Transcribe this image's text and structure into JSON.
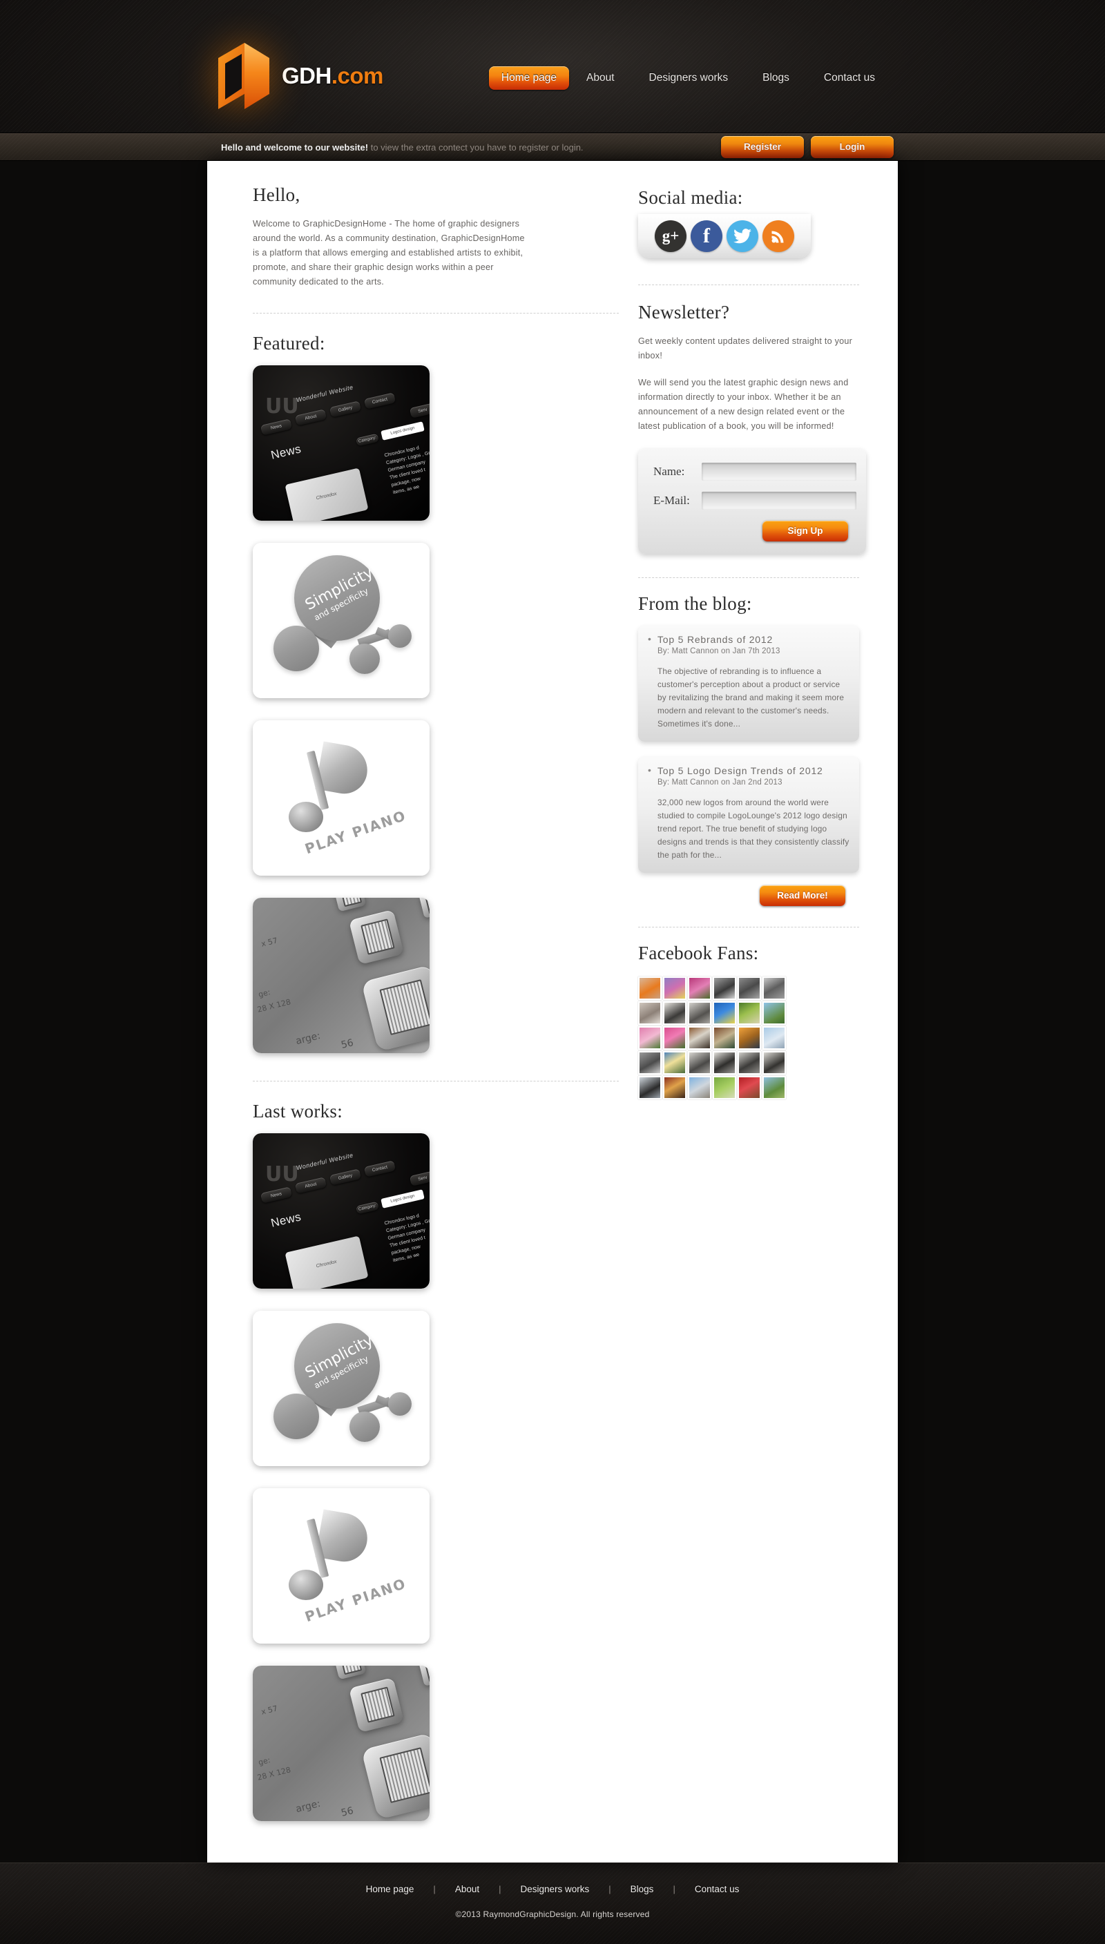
{
  "brand": {
    "name": "GDH",
    "suffix": ".com",
    "logo_icon": "cube-logo-icon"
  },
  "nav": {
    "items": [
      {
        "label": "Home page",
        "active": true
      },
      {
        "label": "About",
        "active": false
      },
      {
        "label": "Designers works",
        "active": false
      },
      {
        "label": "Blogs",
        "active": false
      },
      {
        "label": "Contact us",
        "active": false
      }
    ]
  },
  "welcome": {
    "strong": "Hello and welcome to our website!",
    "dim": "to view the extra contect you have to register or login.",
    "register_label": "Register",
    "login_label": "Login"
  },
  "hello": {
    "heading": "Hello,",
    "paragraph": "Welcome to GraphicDesignHome - The home of graphic designers around the world. As a community destination, GraphicDesignHome is a platform that allows emerging and established artists to exhibit, promote, and share their graphic design works within a peer community dedicated to the arts."
  },
  "featured": {
    "heading": "Featured:",
    "works": [
      {
        "name": "wonderful-website-mockup",
        "style": "tA",
        "title": "Wonderful Website",
        "news": "News",
        "logo": "UU",
        "card": "Chrondox",
        "dropdown": "Logos design",
        "col_lines": [
          "Chrondox logo d",
          "Category: Logos , Gr",
          "German company",
          "The client loved t",
          "package, now",
          "items, as we"
        ],
        "pills": [
          "News",
          "About",
          "Gallery",
          "Contact",
          "Serv"
        ],
        "categ": "Category:"
      },
      {
        "name": "simplicity-logo",
        "style": "tB",
        "line1": "Simplicity",
        "line2": "and specificity"
      },
      {
        "name": "play-piano-logo",
        "style": "tC",
        "caption": "PLAY PIANO"
      },
      {
        "name": "icon-set-showcase",
        "style": "tD",
        "cap1": "x 57",
        "cap2": "ge:",
        "cap3": "28 X 128",
        "cap4": "arge:",
        "cap5": "56"
      }
    ]
  },
  "last_works": {
    "heading": "Last works:",
    "works": [
      {
        "name": "wonderful-website-mockup",
        "style": "tA",
        "title": "Wonderful Website",
        "news": "News",
        "logo": "UU",
        "card": "Chrondox",
        "dropdown": "Logos design",
        "col_lines": [
          "Chrondox logo d",
          "Category: Logos , Gr",
          "German company",
          "The client loved t",
          "package, now",
          "items, as we"
        ],
        "pills": [
          "News",
          "About",
          "Gallery",
          "Contact",
          "Serv"
        ],
        "categ": "Category:"
      },
      {
        "name": "simplicity-logo",
        "style": "tB",
        "line1": "Simplicity",
        "line2": "and specificity"
      },
      {
        "name": "play-piano-logo",
        "style": "tC",
        "caption": "PLAY PIANO"
      },
      {
        "name": "icon-set-showcase",
        "style": "tD",
        "cap1": "x 57",
        "cap2": "ge:",
        "cap3": "28 X 128",
        "cap4": "arge:",
        "cap5": "56"
      }
    ]
  },
  "social": {
    "heading": "Social media:",
    "items": [
      {
        "name": "google-plus-icon",
        "glyph": "g+",
        "color": "#333230"
      },
      {
        "name": "facebook-icon",
        "glyph": "f",
        "color": "#3b5a9b"
      },
      {
        "name": "twitter-icon",
        "glyph": "bird",
        "color": "#4cb3e8"
      },
      {
        "name": "rss-icon",
        "glyph": "rss",
        "color": "#ef7f1f"
      }
    ]
  },
  "newsletter": {
    "heading": "Newsletter?",
    "intro": "Get weekly content updates delivered straight to your inbox!",
    "body": "We will send you the latest graphic design news and information directly to your inbox. Whether it be an announcement of a new design related event or the latest publication of a book, you will be informed!",
    "name_label": "Name:",
    "name_value": "",
    "name_placeholder": "",
    "email_label": "E-Mail:",
    "email_value": "",
    "email_placeholder": "",
    "signup_label": "Sign Up"
  },
  "blog": {
    "heading": "From the blog:",
    "read_more_label": "Read More!",
    "posts": [
      {
        "title": "Top 5 Rebrands of 2012",
        "meta": "By: Matt Cannon on Jan 7th 2013",
        "excerpt": "The objective of rebranding is to influence a customer's perception about a product or service by revitalizing the brand and making it seem more modern and relevant to the customer's needs. Sometimes it's done..."
      },
      {
        "title": "Top 5 Logo Design Trends of 2012",
        "meta": "By: Matt Cannon on Jan 2nd 2013",
        "excerpt": "32,000 new logos from around the world were studied to compile LogoLounge's 2012 logo design trend report. The true benefit of studying logo designs and trends is that they consistently classify the path for the..."
      }
    ]
  },
  "fans": {
    "heading": "Facebook Fans:",
    "rows": 5,
    "cols": 6,
    "thumbs": [
      "butterfly-on-hand",
      "purple-flowers",
      "pink-orchid",
      "bw-rabbit",
      "bw-dolphin",
      "bw-cat-face",
      "grey-kitten",
      "bw-vintage-people",
      "bw-baby",
      "yellow-sunflower-blue-sky",
      "green-leaf-butterfly",
      "mountain-landscape",
      "pink-tulips-pair",
      "pink-tulip-closeup",
      "butterfly-wood",
      "microscope-room",
      "sunset-harbour",
      "city-skyline-tower",
      "grey-cat-closeup",
      "lens-flare-people",
      "bw-field-person",
      "bw-group-people",
      "bw-woman-portrait",
      "bw-outdoor-group",
      "ballet-dancers",
      "indoor-party",
      "statue-building",
      "sheep-green-field",
      "red-uniform-group",
      "lone-tree-field"
    ]
  },
  "footer": {
    "links": [
      "Home page",
      "About",
      "Designers works",
      "Blogs",
      "Contact us"
    ],
    "separator": "|",
    "copyright": "©2013 RaymondGraphicDesign. All rights reserved"
  }
}
